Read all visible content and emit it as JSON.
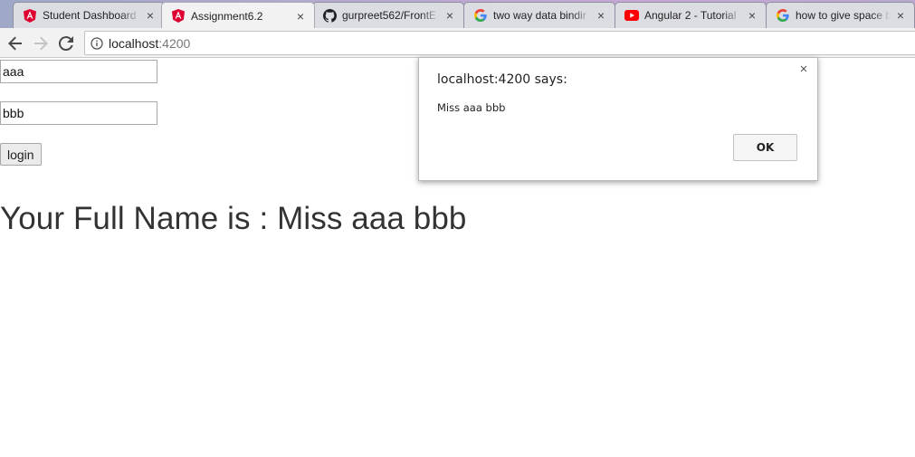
{
  "browser": {
    "tabs": [
      {
        "title": "Student Dashboard",
        "icon": "angular-icon",
        "active": false
      },
      {
        "title": "Assignment6.2",
        "icon": "angular-icon",
        "active": true
      },
      {
        "title": "gurpreet562/FrontE",
        "icon": "github-icon",
        "active": false
      },
      {
        "title": "two way data bindir",
        "icon": "google-icon",
        "active": false
      },
      {
        "title": "Angular 2 - Tutorial",
        "icon": "youtube-icon",
        "active": false
      },
      {
        "title": "how to give space b",
        "icon": "google-icon",
        "active": false
      }
    ],
    "address": {
      "host": "localhost",
      "port": ":4200"
    },
    "colors": {
      "angular_red": "#dd0031",
      "youtube_red": "#ff0000",
      "active_tab": "#f2f2f2"
    }
  },
  "form": {
    "first_name_value": "aaa",
    "last_name_value": "bbb",
    "login_label": "login"
  },
  "result": {
    "text": "Your Full Name is : Miss aaa bbb"
  },
  "dialog": {
    "title": "localhost:4200 says:",
    "message": "Miss aaa bbb",
    "ok_label": "OK",
    "close_glyph": "×"
  }
}
